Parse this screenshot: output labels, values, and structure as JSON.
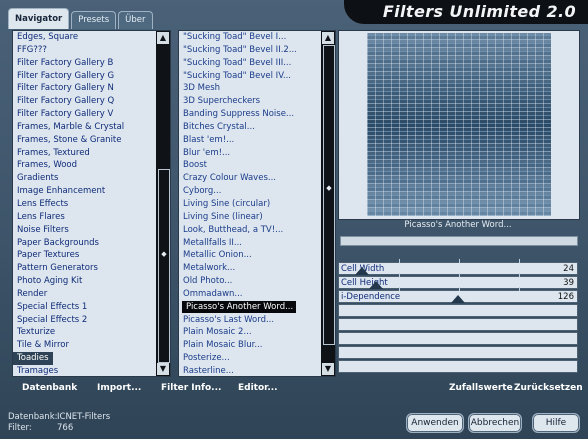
{
  "app": {
    "title": "Filters Unlimited 2.0"
  },
  "tabs": [
    {
      "label": "Navigator"
    },
    {
      "label": "Presets"
    },
    {
      "label": "Über"
    }
  ],
  "categories": [
    "Edges, Square",
    "FFG???",
    "Filter Factory Gallery B",
    "Filter Factory Gallery G",
    "Filter Factory Gallery N",
    "Filter Factory Gallery Q",
    "Filter Factory Gallery V",
    "Frames, Marble & Crystal",
    "Frames, Stone & Granite",
    "Frames, Textured",
    "Frames, Wood",
    "Gradients",
    "Image Enhancement",
    "Lens Effects",
    "Lens Flares",
    "Noise Filters",
    "Paper Backgrounds",
    "Paper Textures",
    "Pattern Generators",
    "Photo Aging Kit",
    "Render",
    "Special Effects 1",
    "Special Effects 2",
    "Texturize",
    "Tile & Mirror",
    "Toadies",
    "Tramages"
  ],
  "selected_category": "Toadies",
  "filters": [
    "\"Sucking Toad\"  Bevel I...",
    "\"Sucking Toad\"  Bevel II.2...",
    "\"Sucking Toad\"  Bevel III...",
    "\"Sucking Toad\"  Bevel IV...",
    "3D Mesh",
    "3D Supercheckers",
    "Banding Suppress Noise...",
    "Bitches Crystal...",
    "Blast 'em!...",
    "Blur 'em!...",
    "Boost",
    "Crazy Colour Waves...",
    "Cyborg...",
    "Living Sine (circular)",
    "Living Sine (linear)",
    "Look, Butthead, a TV!...",
    "Metallfalls II...",
    "Metallic Onion...",
    "Metalwork...",
    "Old Photo...",
    "Ommadawn...",
    "Picasso's Another Word...",
    "Picasso's Last Word...",
    "Plain Mosaic 2...",
    "Plain Mosaic Blur...",
    "Posterize...",
    "Rasterline..."
  ],
  "selected_filter": "Picasso's Another Word...",
  "preview": {
    "filter_name": "Picasso's Another Word..."
  },
  "params": [
    {
      "label": "Cell Width",
      "value": "24",
      "level": 0.094
    },
    {
      "label": "Cell Height",
      "value": "39",
      "level": 0.153
    },
    {
      "label": "i-Dependence",
      "value": "126",
      "level": 0.494
    }
  ],
  "toolbar": {
    "datenbank": "Datenbank",
    "import": "Import...",
    "filter_info": "Filter Info...",
    "editor": "Editor...",
    "zufallswerte": "Zufallswerte",
    "zuruecksetzen": "Zurücksetzen"
  },
  "info": {
    "db_label": "Datenbank:",
    "db_value": "ICNET-Filters",
    "filter_label": "Filter:",
    "filter_value": "766"
  },
  "buttons": {
    "apply": "Anwenden",
    "cancel": "Abbrechen",
    "help": "Hilfe"
  },
  "icons": {
    "scroll_up": "arrow-up-icon",
    "scroll_down": "arrow-down-icon",
    "grip": "scroll-grip-icon"
  }
}
